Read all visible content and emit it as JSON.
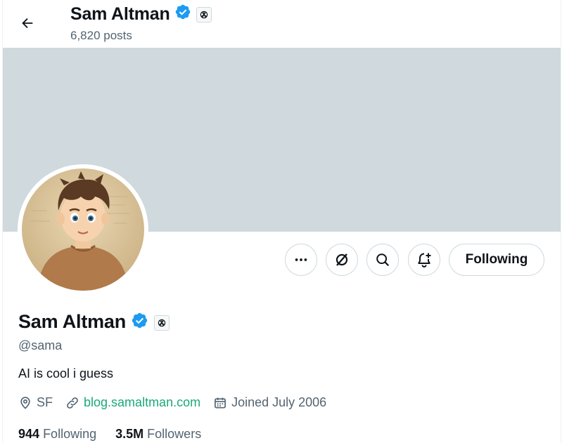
{
  "header": {
    "title": "Sam Altman",
    "posts_count": "6,820 posts"
  },
  "actions": {
    "following_label": "Following"
  },
  "profile": {
    "name": "Sam Altman",
    "handle": "@sama",
    "bio": "AI is cool i guess",
    "location": "SF",
    "website": "blog.samaltman.com",
    "joined": "Joined July 2006",
    "following_count": "944",
    "following_label": "Following",
    "followers_count": "3.5M",
    "followers_label": "Followers"
  },
  "colors": {
    "verified": "#1d9bf0",
    "banner": "#cfd9de",
    "link": "#1ba97a",
    "secondary_text": "#536471"
  },
  "icons": [
    "back-arrow-icon",
    "verified-badge-icon",
    "affiliate-badge-icon",
    "more-icon",
    "grok-icon",
    "search-icon",
    "notification-bell-plus-icon",
    "location-icon",
    "link-icon",
    "calendar-icon"
  ]
}
